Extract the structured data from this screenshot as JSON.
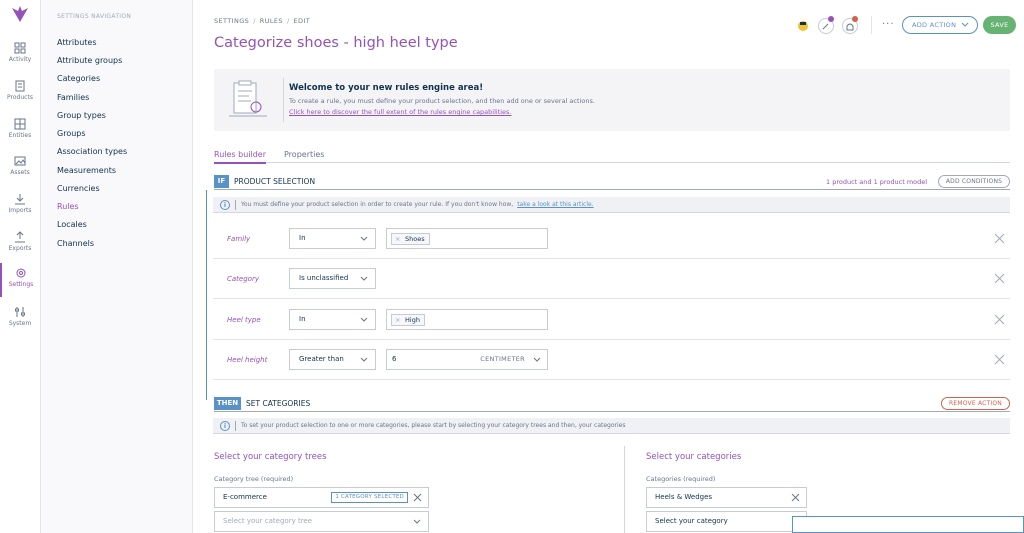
{
  "colors": {
    "primary": "#9452ba",
    "blue": "#5992c7",
    "green": "#67b373",
    "red": "#d4604f",
    "text": "#11324d",
    "muted": "#67768a"
  },
  "nav": {
    "items": [
      {
        "label": "Activity",
        "icon": "activity-icon"
      },
      {
        "label": "Products",
        "icon": "products-icon"
      },
      {
        "label": "Entities",
        "icon": "entities-icon"
      },
      {
        "label": "Assets",
        "icon": "assets-icon"
      },
      {
        "label": "Imports",
        "icon": "imports-icon"
      },
      {
        "label": "Exports",
        "icon": "exports-icon"
      },
      {
        "label": "Settings",
        "icon": "settings-icon"
      },
      {
        "label": "System",
        "icon": "system-icon"
      }
    ]
  },
  "settings_nav": {
    "title": "SETTINGS NAVIGATION",
    "items": [
      "Attributes",
      "Attribute groups",
      "Categories",
      "Families",
      "Group types",
      "Groups",
      "Association types",
      "Measurements",
      "Currencies",
      "Rules",
      "Locales",
      "Channels"
    ]
  },
  "header": {
    "breadcrumb": [
      "SETTINGS",
      "RULES",
      "EDIT"
    ],
    "title": "Categorize shoes - high heel type",
    "more_label": "···",
    "add_action_label": "ADD ACTION",
    "save_label": "SAVE"
  },
  "welcome": {
    "title": "Welcome to your new rules engine area!",
    "text": "To create a rule, you must define your product selection, and then add one or several actions.",
    "link": "Click here to discover the full extent of the rules engine capabilities."
  },
  "tabs": [
    "Rules builder",
    "Properties"
  ],
  "if_section": {
    "badge": "IF",
    "title": "PRODUCT SELECTION",
    "count": "1 product and 1 product model",
    "add_conditions_label": "ADD CONDITIONS",
    "info_text": "You must define your product selection in order to create your rule. If you don't know how,",
    "info_link": "take a look at this article.",
    "conditions": [
      {
        "field": "Family",
        "operator": "In",
        "value": "Shoes"
      },
      {
        "field": "Category",
        "operator": "Is unclassified"
      },
      {
        "field": "Heel type",
        "operator": "In",
        "value": "High"
      },
      {
        "field": "Heel height",
        "operator": "Greater than",
        "value": "6",
        "unit": "CENTIMETER"
      }
    ]
  },
  "then_section": {
    "badge": "THEN",
    "title": "SET CATEGORIES",
    "remove_action_label": "REMOVE ACTION",
    "info_text": "To set your product selection to one or more categories, please start by selecting your category trees and then, your categories",
    "trees": {
      "heading": "Select your category trees",
      "label": "Category tree (required)",
      "selected_tree": "E-commerce",
      "selected_badge": "1 CATEGORY SELECTED",
      "placeholder": "Select your category tree"
    },
    "categories": {
      "heading": "Select your categories",
      "label": "Categories (required)",
      "selected_category": "Heels & Wedges",
      "placeholder": "Select your category"
    }
  }
}
